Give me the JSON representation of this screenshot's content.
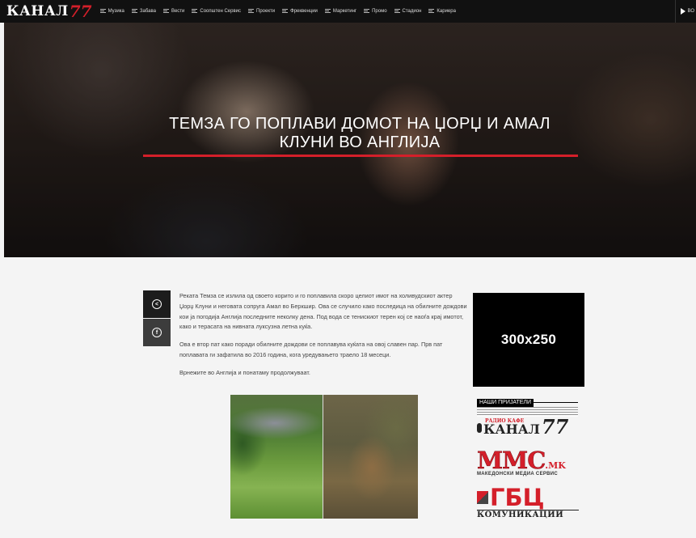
{
  "nav": {
    "logo_text": "КАНАЛ",
    "logo_num": "77",
    "items": [
      "Музика",
      "Забава",
      "Вести",
      "Соопштен Сервис",
      "Проекти",
      "Фреквенции",
      "Маркетинг",
      "Промо",
      "Стадион",
      "Кариера"
    ],
    "right_label": "ВО"
  },
  "hero": {
    "title": "ТЕМЗА ГО ПОПЛАВИ ДОМОТ НА ЏОРЏ И АМАЛ КЛУНИ ВО АНГЛИЈА"
  },
  "share": {
    "share_icon": "share-icon",
    "facebook_icon": "facebook-icon",
    "facebook_glyph": "f"
  },
  "article": {
    "paragraphs": [
      "Реката Темза се излила од своето корито и го поплавила скоро целиот имот на холивудскиот актер Џорџ Клуни и неговата сопруга Амал во Беркшир. Ова се случило како последица на обилните дождови кои ја погодија Англија последните неколку дена. Под вода се тенискиот терен кој се наоѓа крај имотот, како и терасата на нивната луксузна летна куќа.",
      "Ова е втор пат како поради обилните дождови се поплавува куќата на овој славен пар. Прв пат поплавата ги зафатила во 2016 година, кога уредувањето траело 18 месеци.",
      "Врнежите во Англија и понатаму продолжуваат."
    ]
  },
  "sidebar": {
    "ad_label": "300x250",
    "friends_label": "НАШИ ПРИЈАТЕЛИ",
    "partner1": {
      "sub": "РАДИО КАФЕ",
      "name": "КАНАЛ",
      "num": "77"
    },
    "partner2": {
      "name": "MMC",
      "domain": ".MK",
      "sub": "МАКЕДОНСКИ МЕДИА СЕРВИС"
    },
    "partner3": {
      "name": "ГБЦ",
      "sub": "КОМУНИКАЦИИ"
    }
  }
}
